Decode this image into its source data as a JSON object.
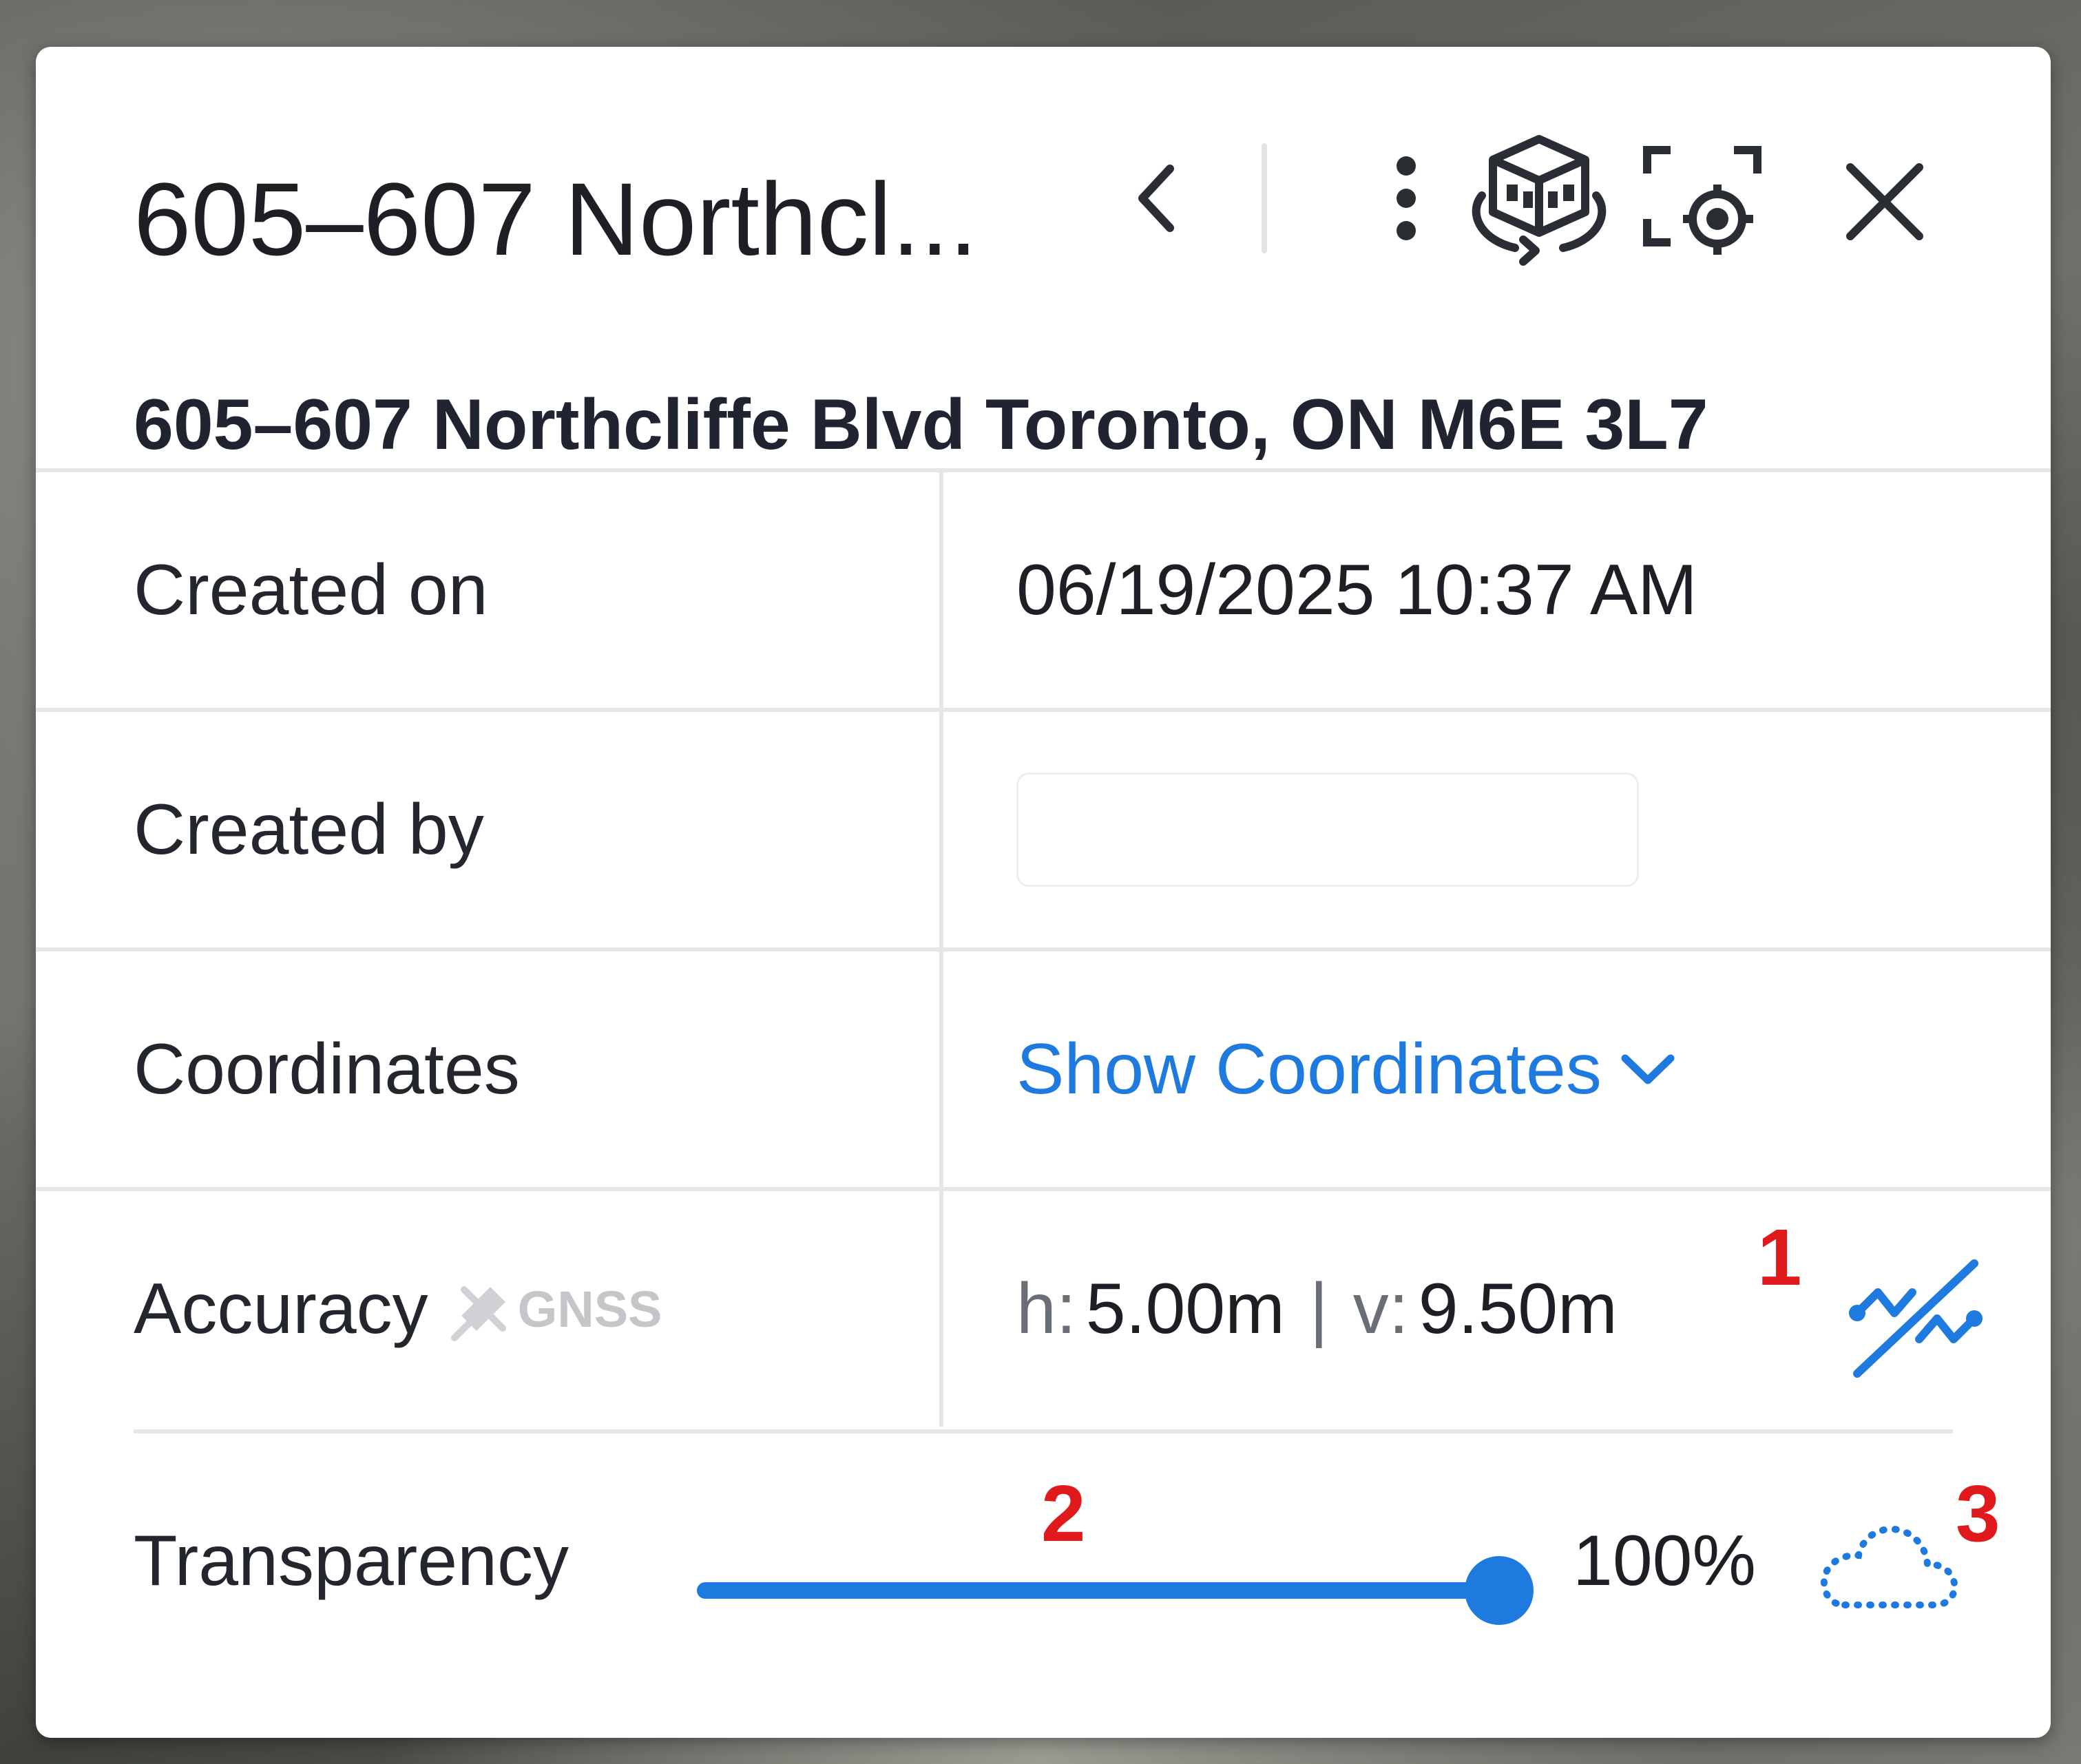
{
  "header": {
    "title": "605–607 Northcl...",
    "back_icon": "chevron-left-icon",
    "more_icon": "more-vertical-icon",
    "model_icon": "3d-building-icon",
    "locate_icon": "focus-target-icon",
    "close_icon": "close-icon"
  },
  "subtitle": "605–607 Northcliffe Blvd Toronto, ON M6E 3L7",
  "rows": {
    "created_on": {
      "label": "Created on",
      "value": "06/19/2025 10:37 AM"
    },
    "created_by": {
      "label": "Created by",
      "value": ""
    },
    "coordinates": {
      "label": "Coordinates",
      "link": "Show Coordinates",
      "icon": "chevron-down-icon"
    },
    "accuracy": {
      "label": "Accuracy",
      "badge": "GNSS",
      "badge_icon": "satellite-icon",
      "h_prefix": "h:",
      "h_value": "5.00m",
      "separator": "|",
      "v_prefix": "v:",
      "v_value": "9.50m",
      "action_icon": "accuracy-adjust-icon"
    }
  },
  "transparency": {
    "label": "Transparency",
    "value_text": "100%",
    "level_percent": 100,
    "action_icon": "dotted-cloud-icon"
  },
  "annotations": [
    "1",
    "2",
    "3"
  ],
  "colors": {
    "accent": "#1f7ae0",
    "annotation": "#e0191c",
    "text": "#1d1f24",
    "border": "#e4e6ea"
  }
}
